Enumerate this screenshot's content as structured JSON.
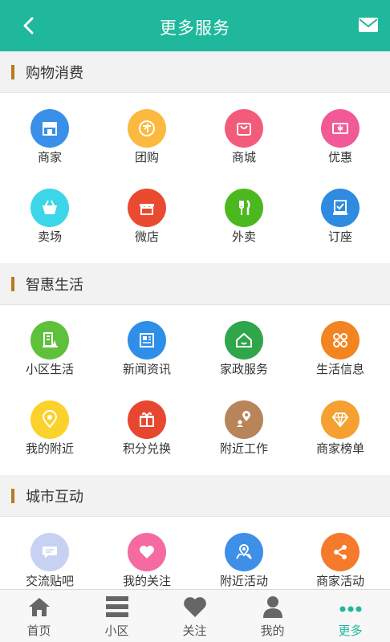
{
  "header": {
    "title": "更多服务"
  },
  "sections": [
    {
      "title": "购物消费",
      "items": [
        {
          "label": "商家",
          "icon": "store-icon",
          "color": "#3a8fe8"
        },
        {
          "label": "团购",
          "icon": "group-buy-icon",
          "color": "#fbb93f"
        },
        {
          "label": "商城",
          "icon": "shopping-bag-icon",
          "color": "#f25c7a"
        },
        {
          "label": "优惠",
          "icon": "coupon-icon",
          "color": "#f25a97"
        },
        {
          "label": "卖场",
          "icon": "basket-icon",
          "color": "#3dd6e8"
        },
        {
          "label": "微店",
          "icon": "shop-front-icon",
          "color": "#ea4a2f"
        },
        {
          "label": "外卖",
          "icon": "fork-knife-icon",
          "color": "#4cb81f"
        },
        {
          "label": "订座",
          "icon": "reserve-icon",
          "color": "#2d8be0"
        }
      ]
    },
    {
      "title": "智惠生活",
      "items": [
        {
          "label": "小区生活",
          "icon": "community-icon",
          "color": "#5fc13b"
        },
        {
          "label": "新闻资讯",
          "icon": "newspaper-icon",
          "color": "#2f8fe8"
        },
        {
          "label": "家政服务",
          "icon": "home-service-icon",
          "color": "#2fa64a"
        },
        {
          "label": "生活信息",
          "icon": "clover-icon",
          "color": "#f28521"
        },
        {
          "label": "我的附近",
          "icon": "location-pin-icon",
          "color": "#fbd22b"
        },
        {
          "label": "积分兑换",
          "icon": "gift-icon",
          "color": "#e8472f"
        },
        {
          "label": "附近工作",
          "icon": "job-location-icon",
          "color": "#b8855a"
        },
        {
          "label": "商家榜单",
          "icon": "diamond-icon",
          "color": "#f5a030"
        }
      ]
    },
    {
      "title": "城市互动",
      "items": [
        {
          "label": "交流贴吧",
          "icon": "chat-icon",
          "color": "#c7d2f2"
        },
        {
          "label": "我的关注",
          "icon": "heart-icon",
          "color": "#f46aa1"
        },
        {
          "label": "附近活动",
          "icon": "map-pin-icon",
          "color": "#3d8fe8"
        },
        {
          "label": "商家活动",
          "icon": "share-icon",
          "color": "#f57a2b"
        }
      ]
    }
  ],
  "tabbar": [
    {
      "label": "首页",
      "icon": "home-icon",
      "active": false
    },
    {
      "label": "小区",
      "icon": "list-icon",
      "active": false
    },
    {
      "label": "关注",
      "icon": "heart-icon",
      "active": false
    },
    {
      "label": "我的",
      "icon": "user-icon",
      "active": false
    },
    {
      "label": "更多",
      "icon": "more-dots-icon",
      "active": true
    }
  ],
  "colors": {
    "primary": "#1fb89c",
    "section_bar": "#b87a1c"
  }
}
